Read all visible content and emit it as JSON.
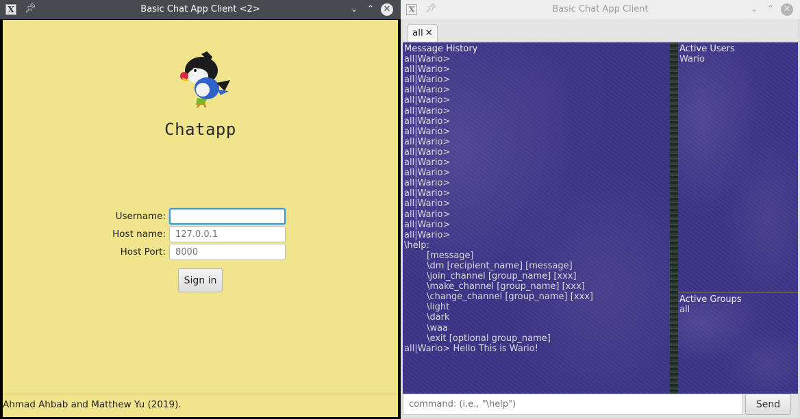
{
  "login_window": {
    "title": "Basic Chat App Client <2>",
    "app_name": "Chatapp",
    "logo_icon": "chatot-bird-icon",
    "username": {
      "label": "Username:",
      "value": "",
      "placeholder": ""
    },
    "hostname": {
      "label": "Host name:",
      "value": "",
      "placeholder": "127.0.0.1"
    },
    "hostport": {
      "label": "Host Port:",
      "value": "",
      "placeholder": "8000"
    },
    "signin_label": "Sign in",
    "credits": "Ahmad Ahbab and Matthew Yu (2019).",
    "background_color": "#f0e48c"
  },
  "chat_window": {
    "title": "Basic Chat App Client",
    "tab": {
      "label": "all",
      "close": "✕"
    },
    "history": {
      "heading": "Message History",
      "lines": [
        "all|Wario>",
        "all|Wario>",
        "all|Wario>",
        "all|Wario>",
        "all|Wario>",
        "all|Wario>",
        "all|Wario>",
        "all|Wario>",
        "all|Wario>",
        "all|Wario>",
        "all|Wario>",
        "all|Wario>",
        "all|Wario>",
        "all|Wario>",
        "all|Wario>",
        "all|Wario>",
        "all|Wario>",
        "all|Wario>",
        "\\help:",
        "        [message]",
        "        \\dm [recipient_name] [message]",
        "        \\join_channel [group_name] [xxx]",
        "        \\make_channel [group_name] [xxx]",
        "        \\change_channel [group_name] [xxx]",
        "        \\light",
        "        \\dark",
        "        \\waa",
        "        \\exit [optional group_name]",
        "all|Wario> Hello This is Wario!"
      ]
    },
    "active_users": {
      "heading": "Active Users",
      "items": [
        "Wario"
      ]
    },
    "active_groups": {
      "heading": "Active Groups",
      "items": [
        "all"
      ]
    },
    "command": {
      "value": "",
      "placeholder": "command: (i.e., \"\\help\")"
    },
    "send_label": "Send",
    "panel_color": "#3a3487"
  }
}
